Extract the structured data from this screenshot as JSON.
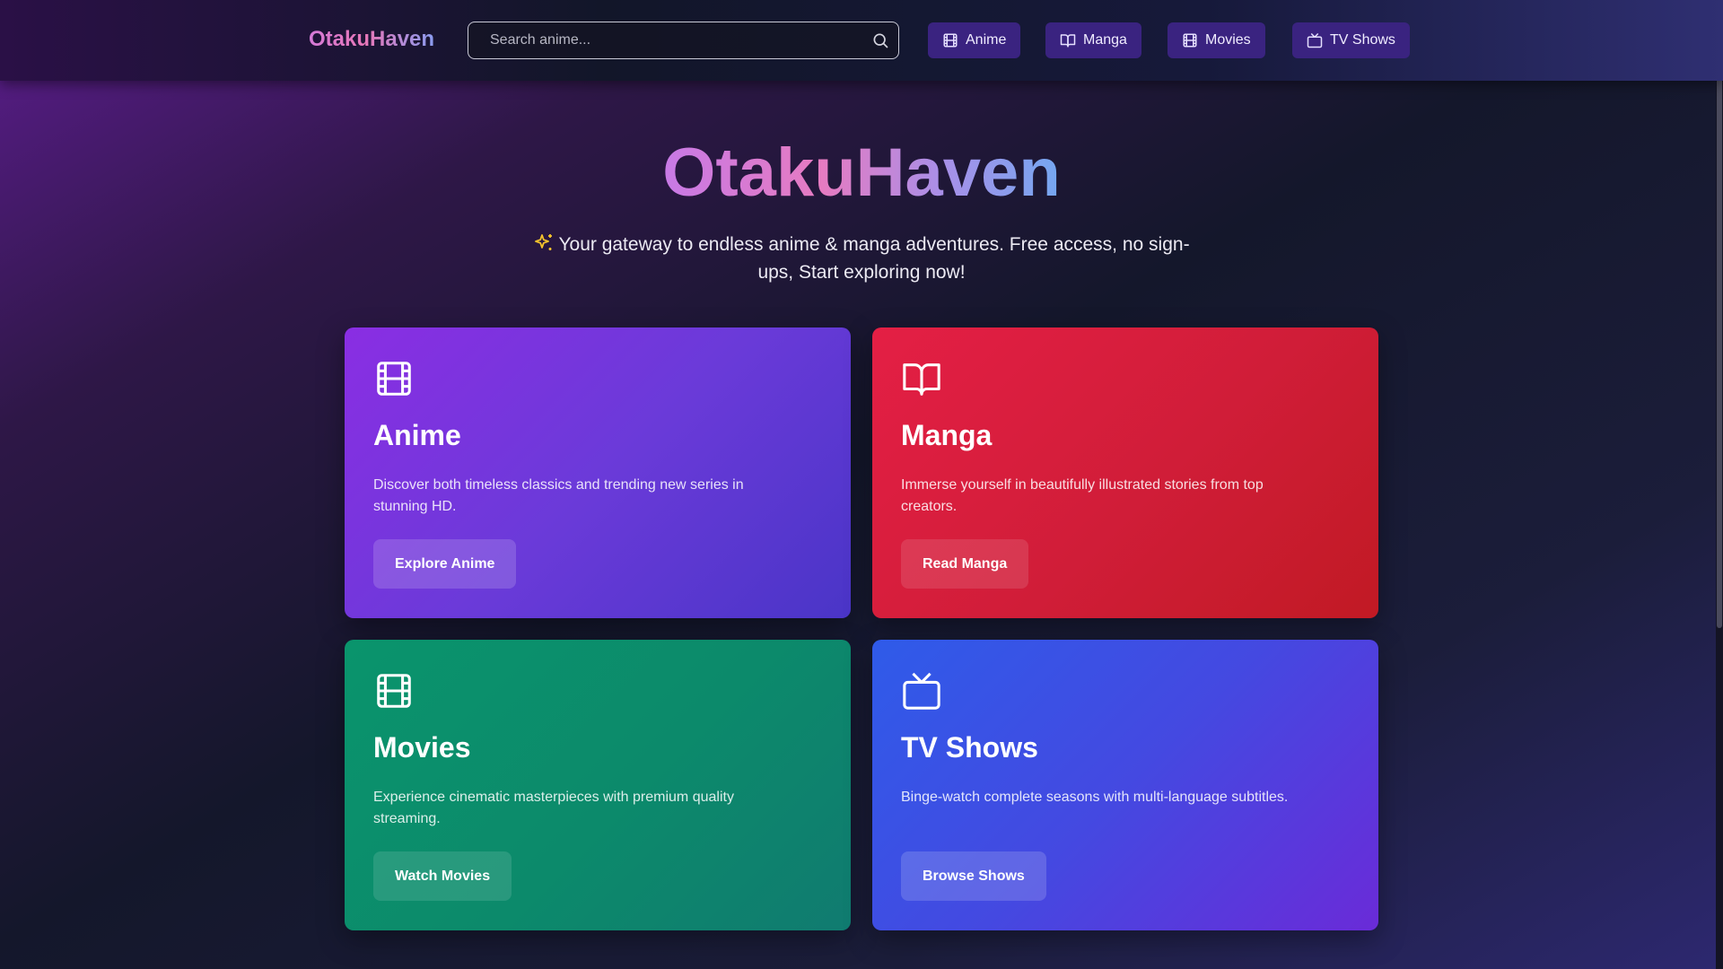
{
  "header": {
    "logo": "OtakuHaven",
    "search": {
      "placeholder": "Search anime...",
      "value": ""
    },
    "nav": [
      {
        "label": "Anime",
        "icon": "film-icon"
      },
      {
        "label": "Manga",
        "icon": "book-open-icon"
      },
      {
        "label": "Movies",
        "icon": "film-icon"
      },
      {
        "label": "TV Shows",
        "icon": "tv-icon"
      }
    ]
  },
  "hero": {
    "title": "OtakuHaven",
    "tagline": "Your gateway to endless anime & manga adventures. Free access, no sign-ups, Start exploring now!",
    "tagline_icon": "sparkles-icon"
  },
  "cards": [
    {
      "title": "Anime",
      "icon": "film-icon",
      "description": "Discover both timeless classics and trending new series in stunning HD.",
      "button": "Explore Anime",
      "color": "#7c3aed"
    },
    {
      "title": "Manga",
      "icon": "book-open-icon",
      "description": "Immerse yourself in beautifully illustrated stories from top creators.",
      "button": "Read Manga",
      "color": "#dc2640"
    },
    {
      "title": "Movies",
      "icon": "film-icon",
      "description": "Experience cinematic masterpieces with premium quality streaming.",
      "button": "Watch Movies",
      "color": "#0d8f6c"
    },
    {
      "title": "TV Shows",
      "icon": "tv-icon",
      "description": "Binge-watch complete seasons with multi-language subtitles.",
      "button": "Browse Shows",
      "color": "#4a4ae0"
    }
  ],
  "colors": {
    "nav_button_bg": "#3a2380",
    "logo_gradient_start": "#d57ad8",
    "logo_gradient_end": "#8a9cf0",
    "sparkle": "#f5c32c"
  }
}
